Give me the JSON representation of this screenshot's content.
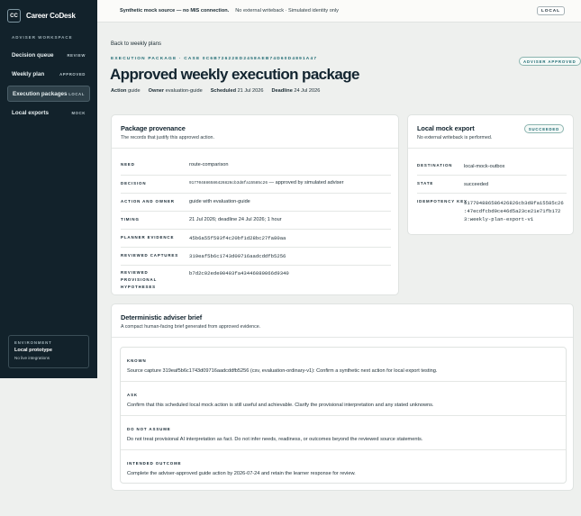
{
  "brand": {
    "logo": "CC",
    "name": "Career CoDesk"
  },
  "sidebar": {
    "section": "ADVISER WORKSPACE",
    "items": [
      {
        "label": "Decision queue",
        "tag": "REVIEW"
      },
      {
        "label": "Weekly plan",
        "tag": "APPROVED"
      },
      {
        "label": "Execution packages",
        "tag": "LOCAL"
      },
      {
        "label": "Local exports",
        "tag": "MOCK"
      }
    ],
    "env": {
      "label": "ENVIRONMENT",
      "title": "Local prototype",
      "sub": "No live integrations"
    }
  },
  "topbar": {
    "strong": "Synthetic mock source — no MIS connection.",
    "muted": "No external writeback · Simulated identity only",
    "badge": "LOCAL"
  },
  "header": {
    "back": "Back to weekly plans",
    "eyebrow": "EXECUTION PACKAGE · CASE 0C6B72622ED2458AEB74D60D4891A47",
    "title": "Approved weekly execution package",
    "status": "ADVISER APPROVED",
    "meta": [
      {
        "k": "Action",
        "v": "guide"
      },
      {
        "k": "Owner",
        "v": "evaluation-guide"
      },
      {
        "k": "Scheduled",
        "v": "21 Jul 2026"
      },
      {
        "k": "Deadline",
        "v": "24 Jul 2026"
      }
    ]
  },
  "provenance": {
    "title": "Package provenance",
    "sub": "The records that justify this approved action.",
    "rows": [
      {
        "k": "NEED",
        "v": "route-comparison"
      },
      {
        "k": "DECISION",
        "v_mono": "917704886586426826cb3d8fa15585c26",
        "v": " — approved by simulated adviser"
      },
      {
        "k": "ACTION AND OWNER",
        "v": "guide with evaluation-guide"
      },
      {
        "k": "TIMING",
        "v": "21 Jul 2026; deadline 24 Jul 2026; 1 hour"
      },
      {
        "k": "PLANNER EVIDENCE",
        "v": "45b6a55f593f4c20bf1d28bc27fa80aa"
      },
      {
        "k": "REVIEWED CAPTURES",
        "v": "319eaf5b6c1743d09716aadcddfb5256"
      },
      {
        "k": "REVIEWED PROVISIONAL HYPOTHESES",
        "v": "b7d2c02ede00403fa43446080066d9340"
      }
    ]
  },
  "export": {
    "title": "Local mock export",
    "sub": "No external writeback is performed.",
    "badge": "SUCCEEDED",
    "rows": [
      {
        "k": "DESTINATION",
        "v": "local-mock-outbox"
      },
      {
        "k": "STATE",
        "v": "succeeded"
      },
      {
        "k": "IDEMPOTENCY KEY",
        "v": "917704886586426826cb3d8fa15585c26 :47ecdfcbd9ce46d5a23ce21e71fb172 3:weekly-plan-export-v1"
      }
    ]
  },
  "brief": {
    "title": "Deterministic adviser brief",
    "sub": "A compact human-facing brief generated from approved evidence.",
    "rows": [
      {
        "k": "KNOWN",
        "v": "Source capture 319eaf5b6c1743d09716aadcddfb5256 (csv, evaluation-ordinary-v1): Confirm a synthetic next action for local export testing."
      },
      {
        "k": "ASK",
        "v": "Confirm that this scheduled local mock action is still useful and achievable. Clarify the provisional interpretation and any stated unknowns."
      },
      {
        "k": "DO NOT ASSUME",
        "v": "Do not treat provisional AI interpretation as fact. Do not infer needs, readiness, or outcomes beyond the reviewed source statements."
      },
      {
        "k": "INTENDED OUTCOME",
        "v": "Complete the adviser-approved guide action by 2026-07-24 and retain the learner response for review."
      }
    ]
  }
}
